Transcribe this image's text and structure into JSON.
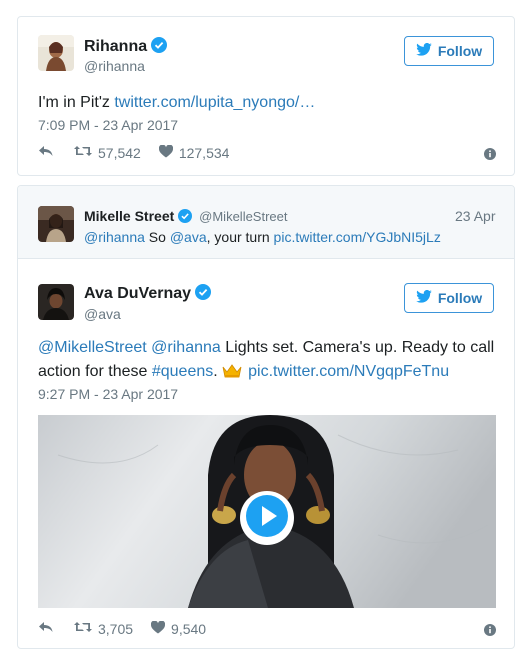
{
  "tweet1": {
    "name": "Rihanna",
    "handle": "@rihanna",
    "follow_label": "Follow",
    "text_plain": "I'm in Pit'z ",
    "text_link": "twitter.com/lupita_nyongo/…",
    "timestamp": "7:09 PM - 23 Apr 2017",
    "retweets": "57,542",
    "likes": "127,534"
  },
  "quoted": {
    "name": "Mikelle Street",
    "handle": "@MikelleStreet",
    "date": "23 Apr",
    "mention": "@rihanna",
    "text1": " So ",
    "mention2": "@ava",
    "text2": ", your turn ",
    "link": "pic.twitter.com/YGJbNI5jLz"
  },
  "tweet2": {
    "name": "Ava DuVernay",
    "handle": "@ava",
    "follow_label": "Follow",
    "mention1": "@MikelleStreet",
    "mention2": "@rihanna",
    "text1": " Lights set. Camera's up. Ready to call",
    "text2": "action for these ",
    "hashtag": "#queens",
    "text3": ". ",
    "link": "pic.twitter.com/NVgqpFeTnu",
    "timestamp": "9:27 PM - 23 Apr 2017",
    "retweets": "3,705",
    "likes": "9,540"
  },
  "colors": {
    "link": "#2b7bb9",
    "verified": "#1da1f2",
    "muted": "#697882"
  }
}
